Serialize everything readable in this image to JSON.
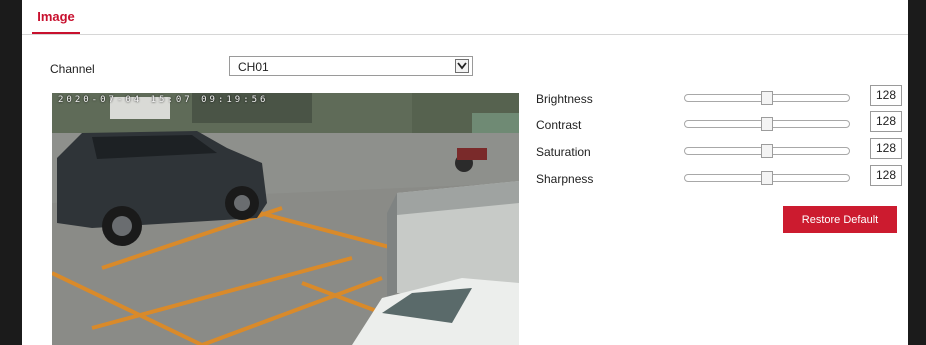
{
  "tabs": [
    {
      "label": "Image",
      "active": true
    }
  ],
  "channel": {
    "label": "Channel",
    "value": "CH01"
  },
  "preview": {
    "osd_timestamp": "2020-07-04 15:07 09:19:56"
  },
  "sliders": [
    {
      "label": "Brightness",
      "value": "128",
      "level": 0.5
    },
    {
      "label": "Contrast",
      "value": "128",
      "level": 0.5
    },
    {
      "label": "Saturation",
      "value": "128",
      "level": 0.5
    },
    {
      "label": "Sharpness",
      "value": "128",
      "level": 0.5
    }
  ],
  "restore_button": {
    "label": "Restore Default"
  },
  "colors": {
    "accent": "#c8102e",
    "button": "#cc1b2f"
  }
}
